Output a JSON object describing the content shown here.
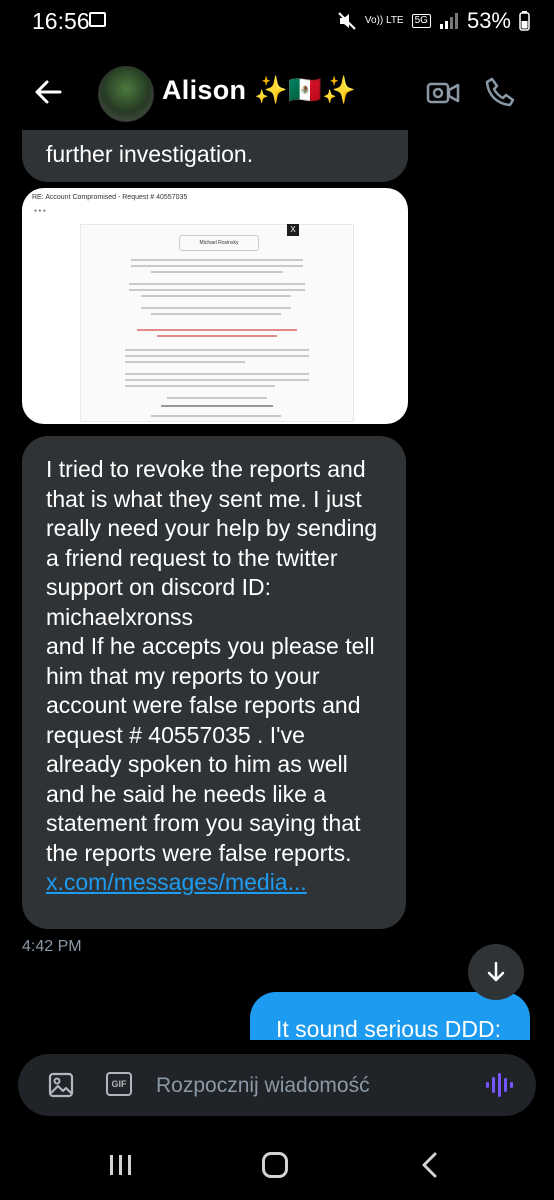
{
  "status": {
    "time": "16:56",
    "network": "5G",
    "volte": "Vo)) LTE",
    "battery": "53%",
    "icons": [
      "gallery-icon",
      "mute-icon",
      "signal-icon"
    ]
  },
  "header": {
    "contact_name": "Alison ✨🇲🇽✨",
    "icons": [
      "back-arrow-icon",
      "video-call-icon",
      "phone-call-icon"
    ]
  },
  "messages": {
    "top_bubble_text": "further investigation.",
    "image": {
      "subject": "RE: Account Compromised - Request # 40557035",
      "sender": "Michael Rosinsky"
    },
    "main_bubble_text": "I tried to revoke the reports and that is what they sent me. I just really need your help by sending a friend request to the twitter support on discord ID: michaelxronss\n and If he accepts you please tell him that my reports to your account were false reports and request # 40557035 . I've already spoken to him as well and he said he needs like a statement from you saying that the reports were false reports.",
    "main_bubble_link": "x.com/messages/media...",
    "timestamp": "4:42 PM",
    "outgoing_text": "It sound serious DDD:"
  },
  "composer": {
    "placeholder": "Rozpocznij wiadomość",
    "gif_label": "GIF"
  },
  "colors": {
    "background": "#000000",
    "incoming_bubble": "#2f3336",
    "outgoing_bubble": "#1d9bf0",
    "link": "#1d9bf0",
    "voice_accent": "#7856ff"
  }
}
